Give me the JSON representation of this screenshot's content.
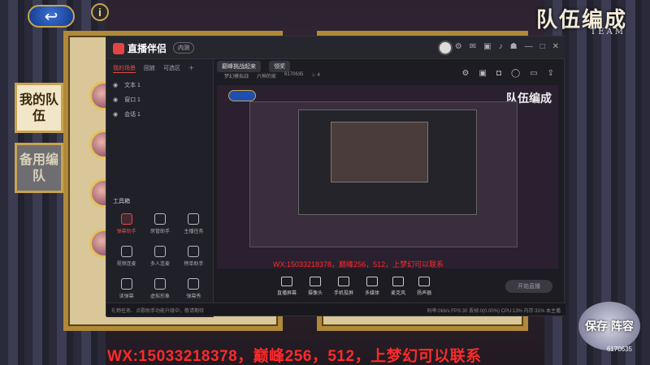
{
  "game": {
    "title": "队伍编成",
    "subtitle": "TEAM",
    "tabs": [
      "我的队伍",
      "备用编队"
    ],
    "back_icon": "back-arrow-icon",
    "info_label": "i"
  },
  "app": {
    "name": "直播伴侣",
    "badge": "内测",
    "avatar_icon": "user-avatar-icon",
    "window_icons": [
      "gear-icon",
      "message-icon",
      "lock-icon",
      "bell-icon",
      "shirt-icon",
      "minimize-icon",
      "maximize-icon",
      "close-icon"
    ],
    "scene_tabs": [
      "我的场景",
      "回放",
      "可选区"
    ],
    "scenes": [
      "文本 1",
      "窗口 1",
      "会话 1"
    ],
    "tools_title": "工具箱",
    "tools": [
      "弹幕助手",
      "房管助手",
      "主播任务",
      "视频连麦",
      "多人连麦",
      "榜单助手",
      "读弹幕",
      "虚拟形象",
      "弹幕秀"
    ],
    "room_tabs": [
      "巅峰挑战起来",
      "领奖"
    ],
    "room_name": "梦幻模拟战",
    "room_id_label": "六神的家",
    "room_id": "6170635",
    "fans": "4",
    "preview_title": "队伍编成",
    "watermark_small": "WX:15033218378，巅峰256，512，上梦幻可以联系",
    "bottom_tools": [
      "直播屏幕",
      "摄像头",
      "手机投屏",
      "多媒体",
      "麦克风",
      "扬声器"
    ],
    "start_live": "开始直播",
    "footer_left": "礼物任务、点歌助手功能升级中，敬请期待",
    "footer_right": "码率:0kb/s   FPS:30   丢帧:0(0.00%)   CPU:13%   内存:31%   本主播"
  },
  "watermark_big": "WX:15033218378，巅峰256，512，上梦幻可以联系",
  "corner": {
    "logo": "保存 阵容",
    "number": "6170635"
  }
}
